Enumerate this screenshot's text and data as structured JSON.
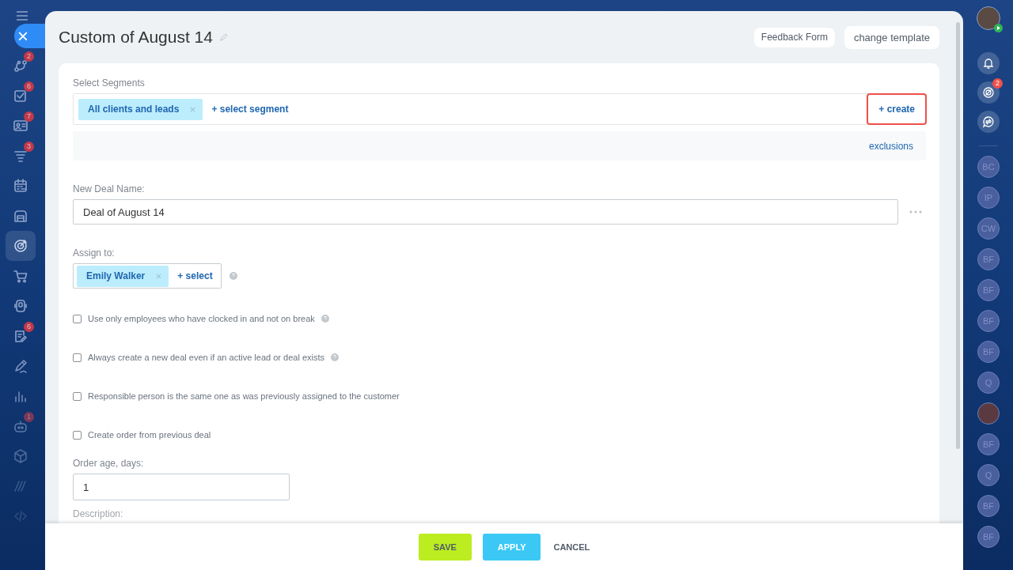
{
  "left_sidebar": {
    "close_button": "×",
    "items": [
      {
        "badge": "2",
        "selected": false
      },
      {
        "badge": "6",
        "selected": false
      },
      {
        "badge": "7",
        "selected": false
      },
      {
        "badge": "3",
        "selected": false
      },
      {
        "selected": false
      },
      {
        "selected": false
      },
      {
        "selected": true
      },
      {
        "selected": false
      },
      {
        "selected": false
      },
      {
        "badge": "6",
        "selected": false
      },
      {
        "selected": false
      },
      {
        "selected": false
      },
      {
        "badge": "1",
        "selected": false
      },
      {
        "selected": false
      },
      {
        "selected": false
      },
      {
        "selected": false
      }
    ]
  },
  "header": {
    "title": "Custom of August 14",
    "buttons": [
      "Feedback Form",
      "change template"
    ]
  },
  "segments": {
    "label": "Select Segments",
    "tags": [
      "All clients and leads"
    ],
    "add_link": "+ select segment",
    "create_button": {
      "label": "+ create",
      "highlighted": true
    },
    "exclusions_link": "exclusions"
  },
  "deal_name": {
    "label": "New Deal Name:",
    "value": "Deal of August 14"
  },
  "assign": {
    "label": "Assign to:",
    "tags": [
      "Emily Walker"
    ],
    "add_link": "+ select"
  },
  "options": [
    {
      "label": "Use only employees who have clocked in and not on break",
      "checked": false,
      "help": true
    },
    {
      "label": "Always create a new deal even if an active lead or deal exists",
      "checked": false,
      "help": true
    },
    {
      "label": "Responsible person is the same one as was previously assigned to the customer",
      "checked": false,
      "help": false
    },
    {
      "label": "Create order from previous deal",
      "checked": false,
      "help": false
    }
  ],
  "order_age": {
    "label": "Order age, days:",
    "value": "1"
  },
  "description": {
    "label": "Description:"
  },
  "footer": {
    "save": "SAVE",
    "apply": "APPLY",
    "cancel": "CANCEL"
  },
  "right_sidebar": {
    "notifications_badge": "2",
    "contacts": [
      {
        "kind": "initials",
        "text": "BC"
      },
      {
        "kind": "initials",
        "text": "IP"
      },
      {
        "kind": "initials",
        "text": "CW"
      },
      {
        "kind": "initials",
        "text": "BF"
      },
      {
        "kind": "initials",
        "text": "BF"
      },
      {
        "kind": "initials",
        "text": "BF"
      },
      {
        "kind": "initials",
        "text": "BF"
      },
      {
        "kind": "initials",
        "text": "Q"
      },
      {
        "kind": "photo"
      },
      {
        "kind": "initials",
        "text": "BF"
      },
      {
        "kind": "initials",
        "text": "Q"
      },
      {
        "kind": "initials",
        "text": "BF"
      },
      {
        "kind": "initials",
        "text": "BF"
      }
    ]
  }
}
